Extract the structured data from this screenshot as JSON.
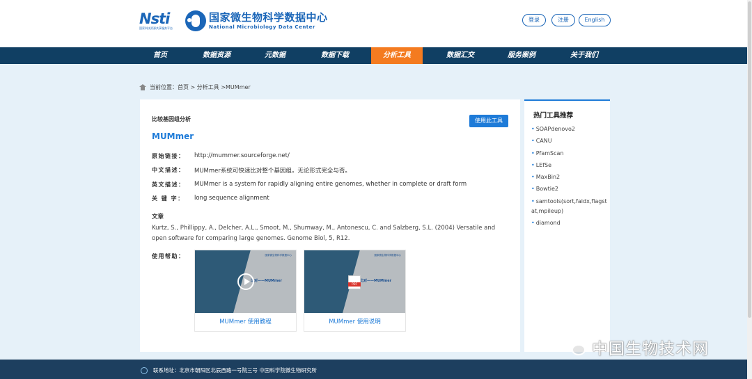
{
  "header": {
    "nsti_logo": "Nsti",
    "nsti_sub": "国家科技资源共享服务平台",
    "title_cn": "国家微生物科学数据中心",
    "title_en": "National Microbiology Data Center",
    "login": "登录",
    "register": "注册",
    "language": "English"
  },
  "nav": {
    "items": [
      "首页",
      "数据资源",
      "元数据",
      "数据下载",
      "分析工具",
      "数据汇交",
      "服务案例",
      "关于我们"
    ],
    "active_index": 4,
    "active_color": "#f47b20"
  },
  "breadcrumb": "当前位置：首页 > 分析工具 >MUMmer",
  "tool": {
    "category": "比较基因组分析",
    "use_button": "使用此工具",
    "name": "MUMmer",
    "fields": [
      {
        "label": "原始链接：",
        "value": "http://mummer.sourceforge.net/"
      },
      {
        "label": "中文描述：",
        "value": "MUMmer系统可快速比对整个基因组，无论形式完全与否。"
      },
      {
        "label": "英文描述：",
        "value": "MUMmer is a system for rapidly aligning entire genomes, whether in complete or draft form"
      },
      {
        "label": "关 键 字：",
        "value": "long sequence alignment"
      }
    ],
    "article_heading": "文章",
    "article_text": "Kurtz, S., Phillippy, A., Delcher, A.L., Smoot, M., Shumway, M., Antonescu, C. and Salzberg, S.L. (2004) Versatile and open software for comparing large genomes. Genome Biol, 5, R12.",
    "help_label": "使用帮助：",
    "help_items": [
      {
        "caption": "MUMmer 使用教程",
        "thumb_title": "比对——MUMmer",
        "icon": "play-icon"
      },
      {
        "caption": "MUMmer 使用说明",
        "thumb_title": "比对——MUMmer",
        "icon": "pdf-icon",
        "pdf_label": "PDF"
      }
    ],
    "thumb_brand": "国家微生物科学数据中心"
  },
  "sidebar": {
    "title": "热门工具推荐",
    "items": [
      "SOAPdenovo2",
      "CANU",
      "PfamScan",
      "LEfSe",
      "MaxBin2",
      "Bowtie2",
      "samtools(sort,faidx,flagstat,mpileup)",
      "diamond"
    ]
  },
  "footer": {
    "address": "联系地址：北京市朝阳区北辰西路一号院三号 中国科学院微生物研究所"
  },
  "watermark": "中国生物技术网",
  "colors": {
    "primary": "#1e7bd8",
    "nav_bg": "#103f63",
    "page_bg": "#e6f1f9",
    "footer_bg": "#1d3f5f"
  }
}
